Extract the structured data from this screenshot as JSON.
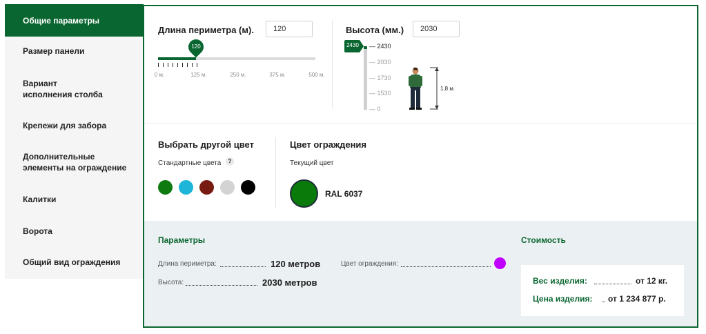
{
  "sidebar": {
    "items": [
      {
        "label": "Общие параметры"
      },
      {
        "label": "Размер панели"
      },
      {
        "label": "Вариант исполнения столба"
      },
      {
        "label": "Крепежи для забора"
      },
      {
        "label": "Дополнительные элементы на ограждение"
      },
      {
        "label": "Калитки"
      },
      {
        "label": "Ворота"
      },
      {
        "label": "Общий вид ограждения"
      }
    ]
  },
  "perimeter": {
    "title": "Длина периметра (м).",
    "input_value": "120",
    "slider_value": "120",
    "slider_min": 0,
    "slider_max": 500,
    "slider_fraction": 0.24,
    "tick_labels": [
      "0 м.",
      "125 м.",
      "250 м.",
      "375 м.",
      "500 м."
    ]
  },
  "height": {
    "title": "Высота (мм.)",
    "input_value": "2030",
    "marker_value": "2430",
    "scale": [
      "2430",
      "2030",
      "1730",
      "1530",
      "0"
    ],
    "person_label": "1,8 м."
  },
  "color_pick": {
    "title": "Выбрать другой цвет",
    "standard_label": "Стандартные цвета",
    "help": "?",
    "swatches": [
      "#0f7a10",
      "#1fb5d8",
      "#781b13",
      "#d3d3d3",
      "#000000"
    ]
  },
  "fence_color": {
    "title": "Цвет ограждения",
    "current_label": "Текущий цвет",
    "current_color": "#0a7a0a",
    "current_name": "RAL 6037"
  },
  "params": {
    "title": "Параметры",
    "perimeter_label": "Длина периметра:",
    "perimeter_value": "120 метров",
    "height_label": "Высота:",
    "height_value": "2030 метров",
    "color_label": "Цвет ограждения:",
    "color_dot": "#c000ff"
  },
  "cost": {
    "title": "Стоимость",
    "weight_label": "Вес изделия:",
    "weight_value": "от 12 кг.",
    "price_label": "Цена изделия:",
    "price_value": "от 1 234 877 р."
  },
  "colors": {
    "accent": "#0a6630",
    "params_bg": "#ebf0f2"
  }
}
